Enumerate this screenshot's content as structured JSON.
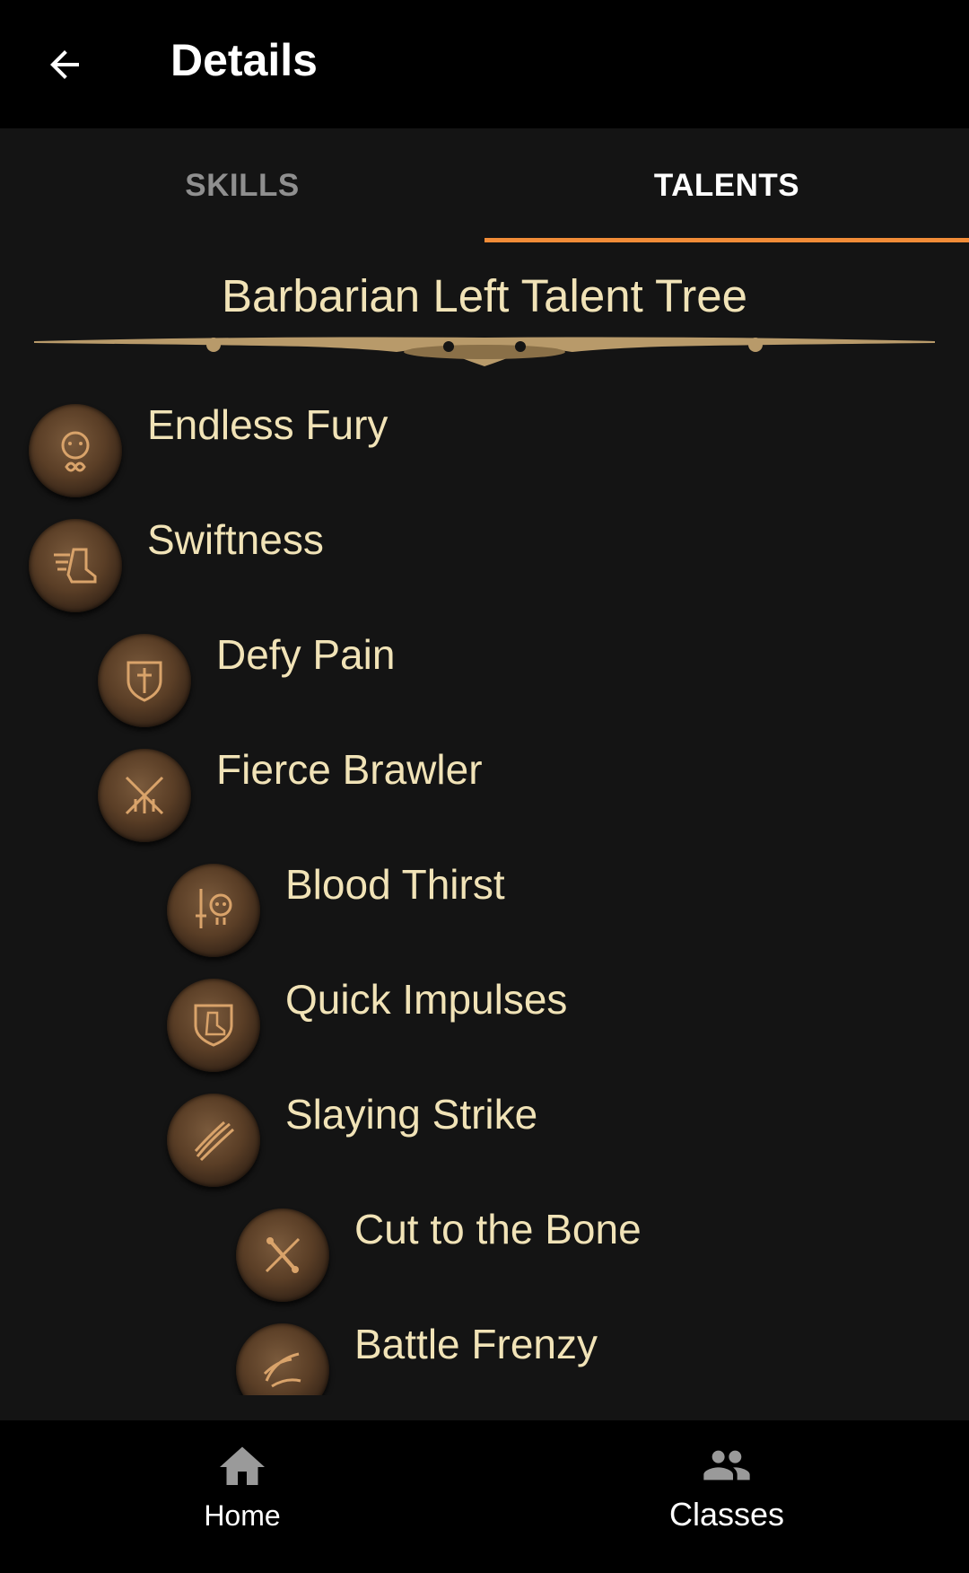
{
  "appbar": {
    "title": "Details",
    "back_icon": "arrow-left-icon"
  },
  "tabs": [
    {
      "label": "SKILLS",
      "active": false
    },
    {
      "label": "TALENTS",
      "active": true
    }
  ],
  "accent_color": "#f28c38",
  "tree": {
    "title": "Barbarian Left Talent Tree",
    "items": [
      {
        "label": "Endless Fury",
        "icon": "face-infinity-icon",
        "depth": 0
      },
      {
        "label": "Swiftness",
        "icon": "winged-boot-icon",
        "depth": 0
      },
      {
        "label": "Defy Pain",
        "icon": "shield-icon",
        "depth": 1
      },
      {
        "label": "Fierce Brawler",
        "icon": "crossed-weapons-icon",
        "depth": 1
      },
      {
        "label": "Blood Thirst",
        "icon": "skull-sword-icon",
        "depth": 2
      },
      {
        "label": "Quick Impulses",
        "icon": "shield-boot-icon",
        "depth": 2
      },
      {
        "label": "Slaying Strike",
        "icon": "slash-icon",
        "depth": 2
      },
      {
        "label": "Cut to the Bone",
        "icon": "bone-sword-icon",
        "depth": 3
      },
      {
        "label": "Battle Frenzy",
        "icon": "frenzy-icon",
        "depth": 3
      }
    ]
  },
  "bottom_nav": [
    {
      "label": "Home",
      "icon": "home-icon"
    },
    {
      "label": "Classes",
      "icon": "people-icon",
      "selected": true
    }
  ]
}
